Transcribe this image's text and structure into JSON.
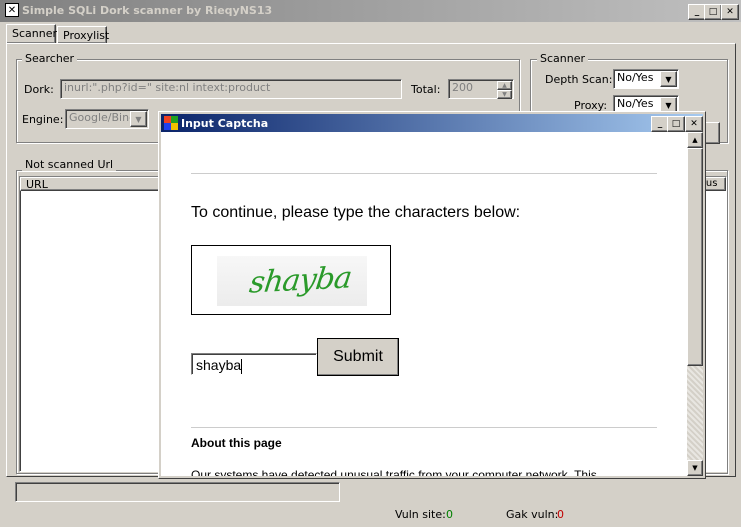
{
  "window": {
    "title": "Simple SQLi Dork scanner by RieqyNS13"
  },
  "tabs": [
    {
      "label": "Scanner"
    },
    {
      "label": "Proxylist"
    }
  ],
  "searcher": {
    "legend": "Searcher",
    "dork_label": "Dork:",
    "dork_value": "inurl:\".php?id=\" site:nl intext:product",
    "total_label": "Total:",
    "total_value": "200",
    "engine_label": "Engine:",
    "engine_value": "Google/Bing"
  },
  "scanner": {
    "legend": "Scanner",
    "depth_label": "Depth Scan:",
    "depth_value": "No/Yes",
    "proxy_label": "Proxy:",
    "proxy_value": "No/Yes"
  },
  "not_scanned": {
    "legend": "Not scanned Url",
    "col_url": "URL",
    "col_status": "tus"
  },
  "status_bar": {
    "vuln_label": "Vuln site:",
    "vuln_value": "0",
    "gak_label": "Gak vuln:",
    "gak_value": "0",
    "vuln_color": "#008000",
    "gak_color": "#c00000"
  },
  "dialog": {
    "title": "Input Captcha",
    "instruction": "To continue, please type the characters below:",
    "captcha_text": "shayba",
    "input_value": "shayba",
    "submit_label": "Submit",
    "about_heading": "About this page",
    "about_text": "Our systems have detected unusual traffic from your computer network. This",
    "title_gradient_start": "#0a246a",
    "title_gradient_end": "#a6caf0"
  }
}
